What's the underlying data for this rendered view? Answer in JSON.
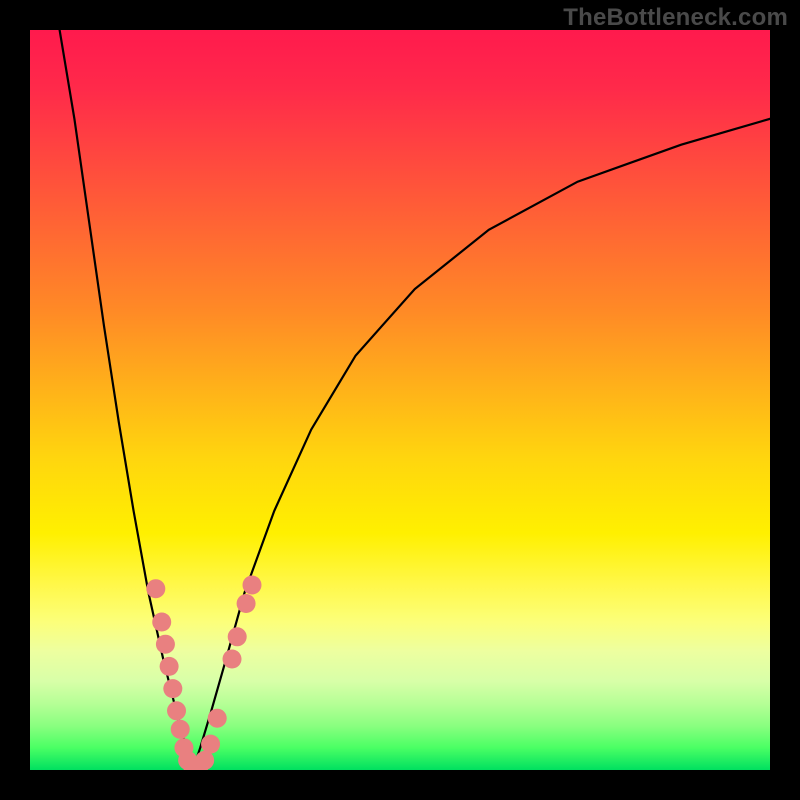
{
  "watermark": "TheBottleneck.com",
  "colors": {
    "curve": "#000000",
    "marker_fill": "#e98080",
    "marker_stroke": "#d06a6a",
    "frame": "#000000"
  },
  "chart_data": {
    "type": "line",
    "title": "",
    "xlabel": "",
    "ylabel": "",
    "xlim": [
      0,
      100
    ],
    "ylim": [
      0,
      100
    ],
    "note": "V-shaped bottleneck curve; vertex near x≈22, y≈0. Left branch rises steeply toward y=100 at x≈4; right branch rises asymptotically toward y≈88 at x=100. Axes are unlabeled; values are positional estimates (percent of plot area).",
    "series": [
      {
        "name": "left-branch",
        "x": [
          4.0,
          6.0,
          8.0,
          10.0,
          12.0,
          14.0,
          16.0,
          18.0,
          19.5,
          20.5,
          21.5,
          22.0
        ],
        "values": [
          100.0,
          88.0,
          74.0,
          60.0,
          47.0,
          35.0,
          24.0,
          15.0,
          9.0,
          5.0,
          2.0,
          0.0
        ]
      },
      {
        "name": "right-branch",
        "x": [
          22.0,
          23.0,
          24.5,
          26.5,
          29.0,
          33.0,
          38.0,
          44.0,
          52.0,
          62.0,
          74.0,
          88.0,
          100.0
        ],
        "values": [
          0.0,
          3.0,
          8.0,
          15.0,
          24.0,
          35.0,
          46.0,
          56.0,
          65.0,
          73.0,
          79.5,
          84.5,
          88.0
        ]
      }
    ],
    "markers": {
      "name": "highlighted-points",
      "note": "Salmon dots clustered near the curve vertex on both branches.",
      "points": [
        {
          "x": 17.0,
          "y": 24.5
        },
        {
          "x": 17.8,
          "y": 20.0
        },
        {
          "x": 18.3,
          "y": 17.0
        },
        {
          "x": 18.8,
          "y": 14.0
        },
        {
          "x": 19.3,
          "y": 11.0
        },
        {
          "x": 19.8,
          "y": 8.0
        },
        {
          "x": 20.3,
          "y": 5.5
        },
        {
          "x": 20.8,
          "y": 3.0
        },
        {
          "x": 21.3,
          "y": 1.3
        },
        {
          "x": 22.0,
          "y": 0.4
        },
        {
          "x": 22.8,
          "y": 0.4
        },
        {
          "x": 23.6,
          "y": 1.3
        },
        {
          "x": 24.4,
          "y": 3.5
        },
        {
          "x": 25.3,
          "y": 7.0
        },
        {
          "x": 27.3,
          "y": 15.0
        },
        {
          "x": 28.0,
          "y": 18.0
        },
        {
          "x": 29.2,
          "y": 22.5
        },
        {
          "x": 30.0,
          "y": 25.0
        }
      ]
    }
  }
}
